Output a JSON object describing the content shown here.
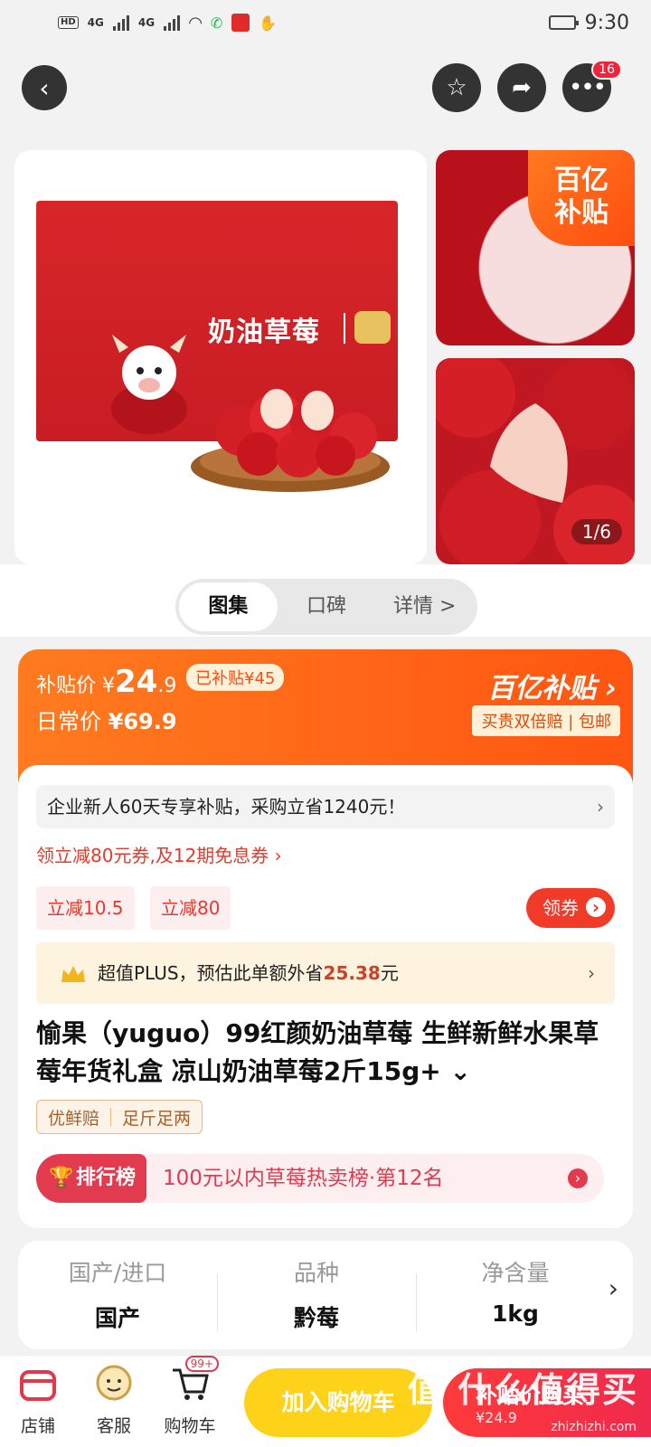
{
  "status": {
    "time": "9:30",
    "net1": "4G",
    "net2": "4G",
    "hd1": "HD",
    "hd2": "HD"
  },
  "nav": {
    "back_icon": "chevron-left-icon",
    "fav_icon": "star-icon",
    "share_icon": "share-icon",
    "more_icon": "more-icon",
    "more_badge": "16"
  },
  "gallery": {
    "box_title": "奶油草莓",
    "corner_badge_line1": "百亿",
    "corner_badge_line2": "补贴",
    "counter": "1/6"
  },
  "tabs": [
    {
      "label": "图集"
    },
    {
      "label": "口碑"
    },
    {
      "label": "详情 >"
    }
  ],
  "price": {
    "subsidy_label": "补贴价",
    "subsidy_currency": "¥",
    "subsidy_int": "24",
    "subsidy_dec": ".9",
    "subsidized_tag": "已补贴¥45",
    "daily_label": "日常价",
    "daily_price": "¥69.9",
    "billion_title": "百亿补贴 ›",
    "billion_sub": "买贵双倍赔 | 包邮"
  },
  "promo": {
    "enterprise": "企业新人60天专享补贴，采购立省1240元！",
    "coupon_line": "领立减80元券,及12期免息券 ›",
    "chip1": "立减10.5",
    "chip2": "立减80",
    "get_coupon": "领券",
    "plus_text1": "超值PLUS，预估此单额外省",
    "plus_amount": "25.38",
    "plus_text2": "元"
  },
  "product": {
    "title": "愉果（yuguo）99红颜奶油草莓 生鲜新鲜水果草莓年货礼盒 凉山奶油草莓2斤15g+ ⌄",
    "tag1": "优鲜赔",
    "tag2": "足斤足两",
    "rank_badge": "排行榜",
    "rank_text": "100元以内草莓热卖榜·第12名"
  },
  "specs": [
    {
      "key": "国产/进口",
      "value": "国产"
    },
    {
      "key": "品种",
      "value": "黔莓"
    },
    {
      "key": "净含量",
      "value": "1kg"
    }
  ],
  "bottom": {
    "shop": "店铺",
    "service": "客服",
    "cart": "购物车",
    "cart_badge": "99+",
    "add_cart": "加入购物车",
    "buy_line1": "补贴价购买",
    "buy_line2": "¥24.9",
    "watermark": "值 什么值得买",
    "watermark_sub": "zhizhizhi.com"
  },
  "colors": {
    "accent_orange": "#ff5511",
    "accent_red": "#f13a27",
    "cart_yellow": "#ffd21a"
  }
}
